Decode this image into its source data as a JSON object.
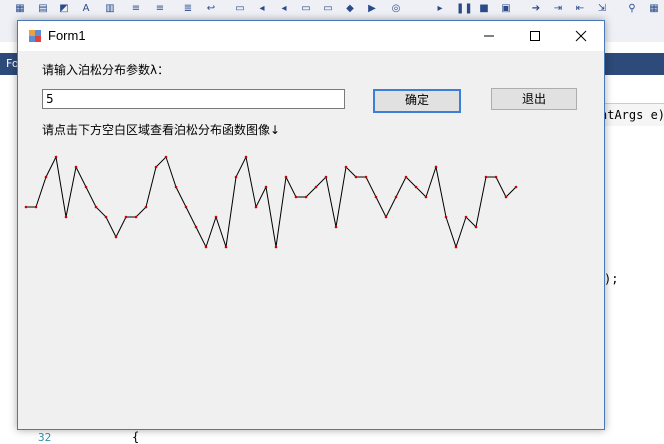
{
  "ide": {
    "code_right": "ntArgs e)",
    "code_right2": ");",
    "line_number": "32",
    "brace": "{",
    "tab_fragment": "Fo"
  },
  "window": {
    "title": "Form1",
    "minimize_label": "—",
    "maximize_label": "☐",
    "close_label": "✕"
  },
  "form": {
    "prompt_label": "请输入泊松分布参数λ：",
    "input_value": "5",
    "confirm_label": "确定",
    "exit_label": "退出",
    "hint_label": "请点击下方空白区域查看泊松分布函数图像↓"
  },
  "chart_data": {
    "type": "line",
    "x": [
      0,
      1,
      2,
      3,
      4,
      5,
      6,
      7,
      8,
      9,
      10,
      11,
      12,
      13,
      14,
      15,
      16,
      17,
      18,
      19,
      20,
      21,
      22,
      23,
      24,
      25,
      26,
      27,
      28,
      29,
      30,
      31,
      32,
      33,
      34,
      35,
      36,
      37,
      38,
      39,
      40,
      41,
      42,
      43,
      44,
      45,
      46,
      47,
      48,
      49
    ],
    "values": [
      5,
      5,
      8,
      10,
      4,
      9,
      7,
      5,
      4,
      2,
      4,
      4,
      5,
      9,
      10,
      7,
      5,
      3,
      1,
      4,
      1,
      8,
      10,
      5,
      7,
      1,
      8,
      6,
      6,
      7,
      8,
      3,
      9,
      8,
      8,
      6,
      4,
      6,
      8,
      7,
      6,
      9,
      4,
      1,
      4,
      3,
      8,
      8,
      6,
      7
    ],
    "ylim": [
      0,
      11
    ],
    "color": "#000000",
    "marker_color": "#cc0000"
  }
}
